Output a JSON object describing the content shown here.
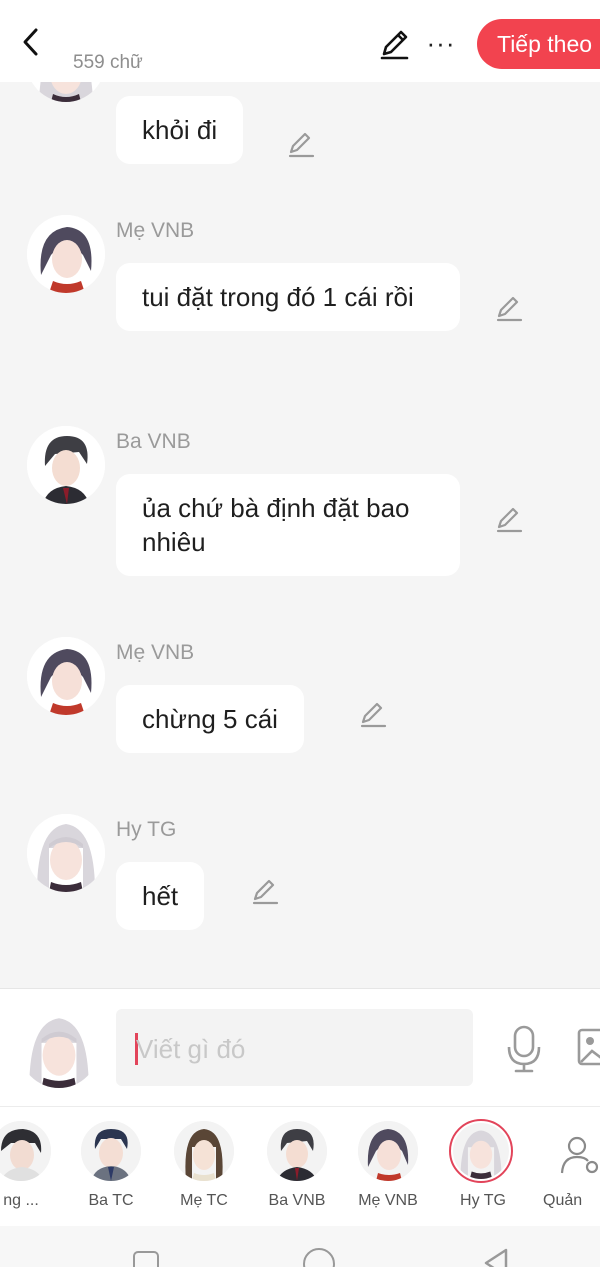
{
  "header": {
    "word_count": "559 chữ",
    "next_label": "Tiếp theo",
    "more_label": "···"
  },
  "messages": [
    {
      "sender": "",
      "text": "khỏi đi",
      "avatar": "hy-tg-avatar"
    },
    {
      "sender": "Mẹ VNB",
      "text": "tui đặt trong đó 1 cái rồi",
      "avatar": "me-vnb-avatar"
    },
    {
      "sender": "Ba VNB",
      "text": "ủa chứ bà định đặt bao nhiêu",
      "avatar": "ba-vnb-avatar"
    },
    {
      "sender": "Mẹ VNB",
      "text": "chừng 5 cái",
      "avatar": "me-vnb-avatar"
    },
    {
      "sender": "Hy TG",
      "text": "hết",
      "avatar": "hy-tg-avatar"
    }
  ],
  "composer": {
    "placeholder": "Viết gì đó"
  },
  "characters": [
    {
      "name": "ng ...",
      "selected": false
    },
    {
      "name": "Ba TC",
      "selected": false
    },
    {
      "name": "Mẹ TC",
      "selected": false
    },
    {
      "name": "Ba VNB",
      "selected": false
    },
    {
      "name": "Mẹ VNB",
      "selected": false
    },
    {
      "name": "Hy TG",
      "selected": true
    },
    {
      "name": "Quản",
      "selected": false
    }
  ],
  "colors": {
    "accent": "#f2434f",
    "background": "#f5f5f5",
    "bubble": "#ffffff"
  }
}
